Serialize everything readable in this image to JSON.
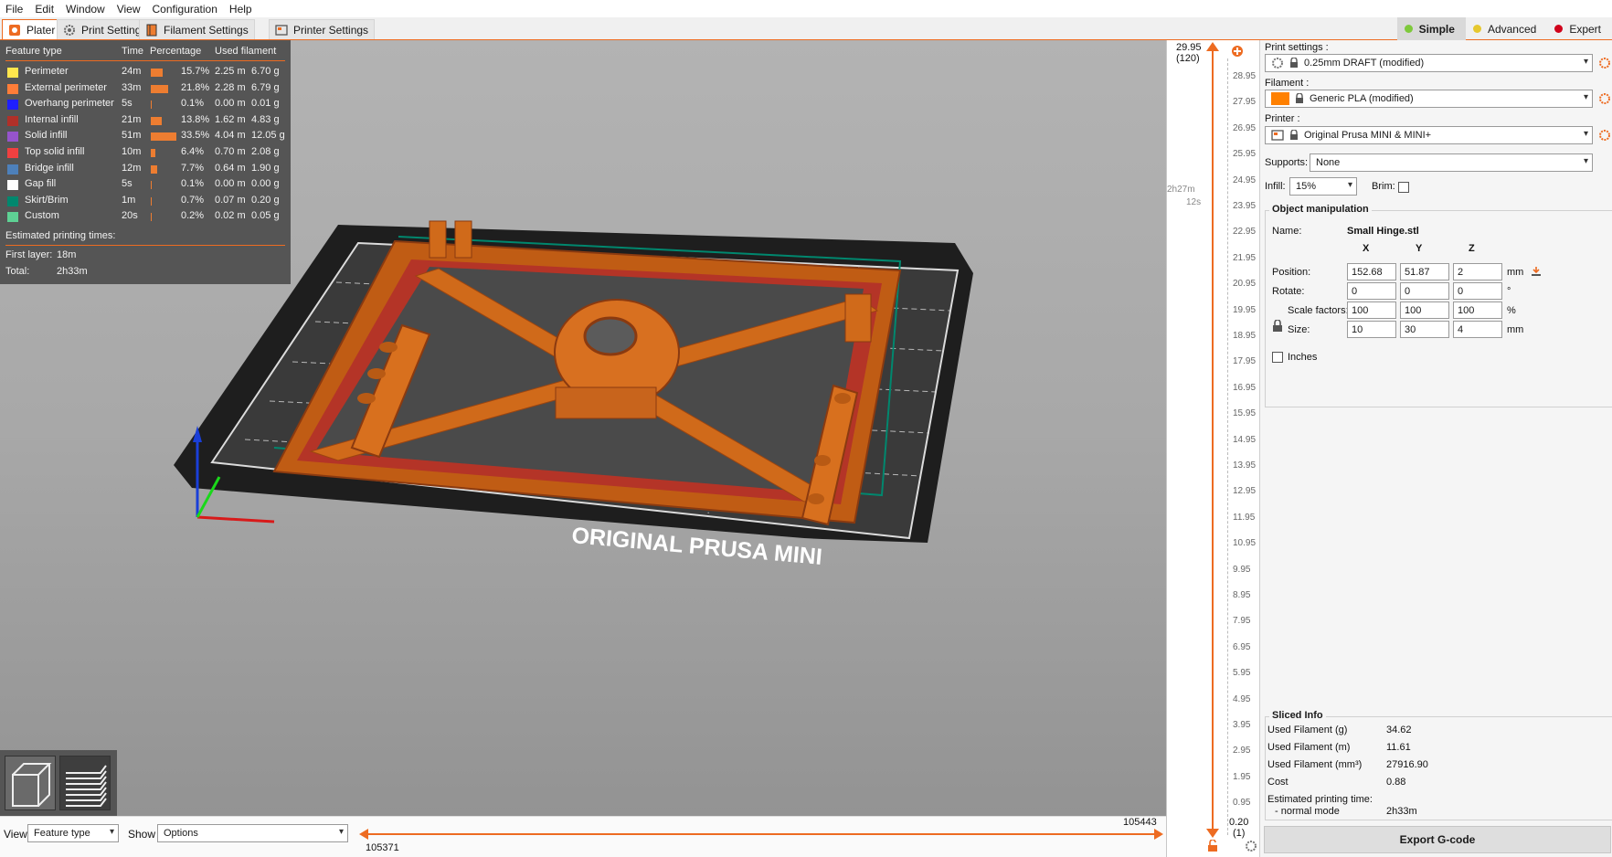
{
  "menu": [
    "File",
    "Edit",
    "Window",
    "View",
    "Configuration",
    "Help"
  ],
  "tabs": [
    {
      "label": "Plater",
      "active": true
    },
    {
      "label": "Print Settings",
      "active": false
    },
    {
      "label": "Filament Settings",
      "active": false
    },
    {
      "label": "Printer Settings",
      "active": false
    }
  ],
  "modes": [
    {
      "label": "Simple",
      "color": "#7ec93b",
      "active": true
    },
    {
      "label": "Advanced",
      "color": "#e6c82f",
      "active": false
    },
    {
      "label": "Expert",
      "color": "#d0021b",
      "active": false
    }
  ],
  "legend": {
    "headers": {
      "type": "Feature type",
      "time": "Time",
      "pct": "Percentage",
      "used": "Used filament"
    },
    "rows": [
      {
        "name": "Perimeter",
        "color": "#ffe64d",
        "time": "24m",
        "pct": "15.7%",
        "m": "2.25 m",
        "g": "6.70 g",
        "share": 15.7
      },
      {
        "name": "External perimeter",
        "color": "#ff7d38",
        "time": "33m",
        "pct": "21.8%",
        "m": "2.28 m",
        "g": "6.79 g",
        "share": 21.8
      },
      {
        "name": "Overhang perimeter",
        "color": "#1f1fff",
        "time": "5s",
        "pct": "0.1%",
        "m": "0.00 m",
        "g": "0.01 g",
        "share": 0.1
      },
      {
        "name": "Internal infill",
        "color": "#b03029",
        "time": "21m",
        "pct": "13.8%",
        "m": "1.62 m",
        "g": "4.83 g",
        "share": 13.8
      },
      {
        "name": "Solid infill",
        "color": "#9654cc",
        "time": "51m",
        "pct": "33.5%",
        "m": "4.04 m",
        "g": "12.05 g",
        "share": 33.5
      },
      {
        "name": "Top solid infill",
        "color": "#f04040",
        "time": "10m",
        "pct": "6.4%",
        "m": "0.70 m",
        "g": "2.08 g",
        "share": 6.4
      },
      {
        "name": "Bridge infill",
        "color": "#4d80ba",
        "time": "12m",
        "pct": "7.7%",
        "m": "0.64 m",
        "g": "1.90 g",
        "share": 7.7
      },
      {
        "name": "Gap fill",
        "color": "#ffffff",
        "time": "5s",
        "pct": "0.1%",
        "m": "0.00 m",
        "g": "0.00 g",
        "share": 0.1
      },
      {
        "name": "Skirt/Brim",
        "color": "#00876e",
        "time": "1m",
        "pct": "0.7%",
        "m": "0.07 m",
        "g": "0.20 g",
        "share": 0.7
      },
      {
        "name": "Custom",
        "color": "#5ed194",
        "time": "20s",
        "pct": "0.2%",
        "m": "0.02 m",
        "g": "0.05 g",
        "share": 0.2
      }
    ],
    "est_title": "Estimated printing times:",
    "first_layer_label": "First layer:",
    "first_layer": "18m",
    "total_label": "Total:",
    "total": "2h33m"
  },
  "bed_label": "ORIGINAL PRUSA MINI",
  "vslider": {
    "top_value": "29.95",
    "top_layer": "(120)",
    "time_a": "2h27m",
    "time_b": "12s",
    "ticks": [
      "28.95",
      "27.95",
      "26.95",
      "25.95",
      "24.95",
      "23.95",
      "22.95",
      "21.95",
      "20.95",
      "19.95",
      "18.95",
      "17.95",
      "16.95",
      "15.95",
      "14.95",
      "13.95",
      "12.95",
      "11.95",
      "10.95",
      "9.95",
      "8.95",
      "7.95",
      "6.95",
      "5.95",
      "4.95",
      "3.95",
      "2.95",
      "1.95",
      "0.95"
    ],
    "bottom_value": "0.20",
    "bottom_layer": "(1)"
  },
  "sidebar": {
    "print_settings_label": "Print settings :",
    "print_settings_value": "0.25mm DRAFT (modified)",
    "filament_label": "Filament :",
    "filament_value": "Generic PLA (modified)",
    "filament_color": "#ff8000",
    "printer_label": "Printer :",
    "printer_value": "Original Prusa MINI & MINI+",
    "supports_label": "Supports:",
    "supports_value": "None",
    "infill_label": "Infill:",
    "infill_value": "15%",
    "brim_label": "Brim:",
    "object": {
      "title": "Object manipulation",
      "name_label": "Name:",
      "name_value": "Small Hinge.stl",
      "x": "X",
      "y": "Y",
      "z": "Z",
      "position_label": "Position:",
      "position": [
        "152.68",
        "51.87",
        "2"
      ],
      "position_unit": "mm",
      "rotate_label": "Rotate:",
      "rotate": [
        "0",
        "0",
        "0"
      ],
      "rotate_unit": "°",
      "scale_label": "Scale factors:",
      "scale": [
        "100",
        "100",
        "100"
      ],
      "scale_unit": "%",
      "size_label": "Size:",
      "size": [
        "10",
        "30",
        "4"
      ],
      "size_unit": "mm",
      "inches_label": "Inches"
    },
    "sliced": {
      "title": "Sliced Info",
      "rows": [
        {
          "label": "Used Filament (g)",
          "value": "34.62"
        },
        {
          "label": "Used Filament (m)",
          "value": "11.61"
        },
        {
          "label": "Used Filament (mm³)",
          "value": "27916.90"
        },
        {
          "label": "Cost",
          "value": "0.88"
        }
      ],
      "est_label": "Estimated printing time:",
      "mode_label": "- normal mode",
      "mode_value": "2h33m"
    },
    "export_label": "Export G-code"
  },
  "bottom": {
    "view_label": "View",
    "view_value": "Feature type",
    "show_label": "Show",
    "show_value": "Options",
    "hslider_end": "105443",
    "hslider_start": "105371"
  }
}
